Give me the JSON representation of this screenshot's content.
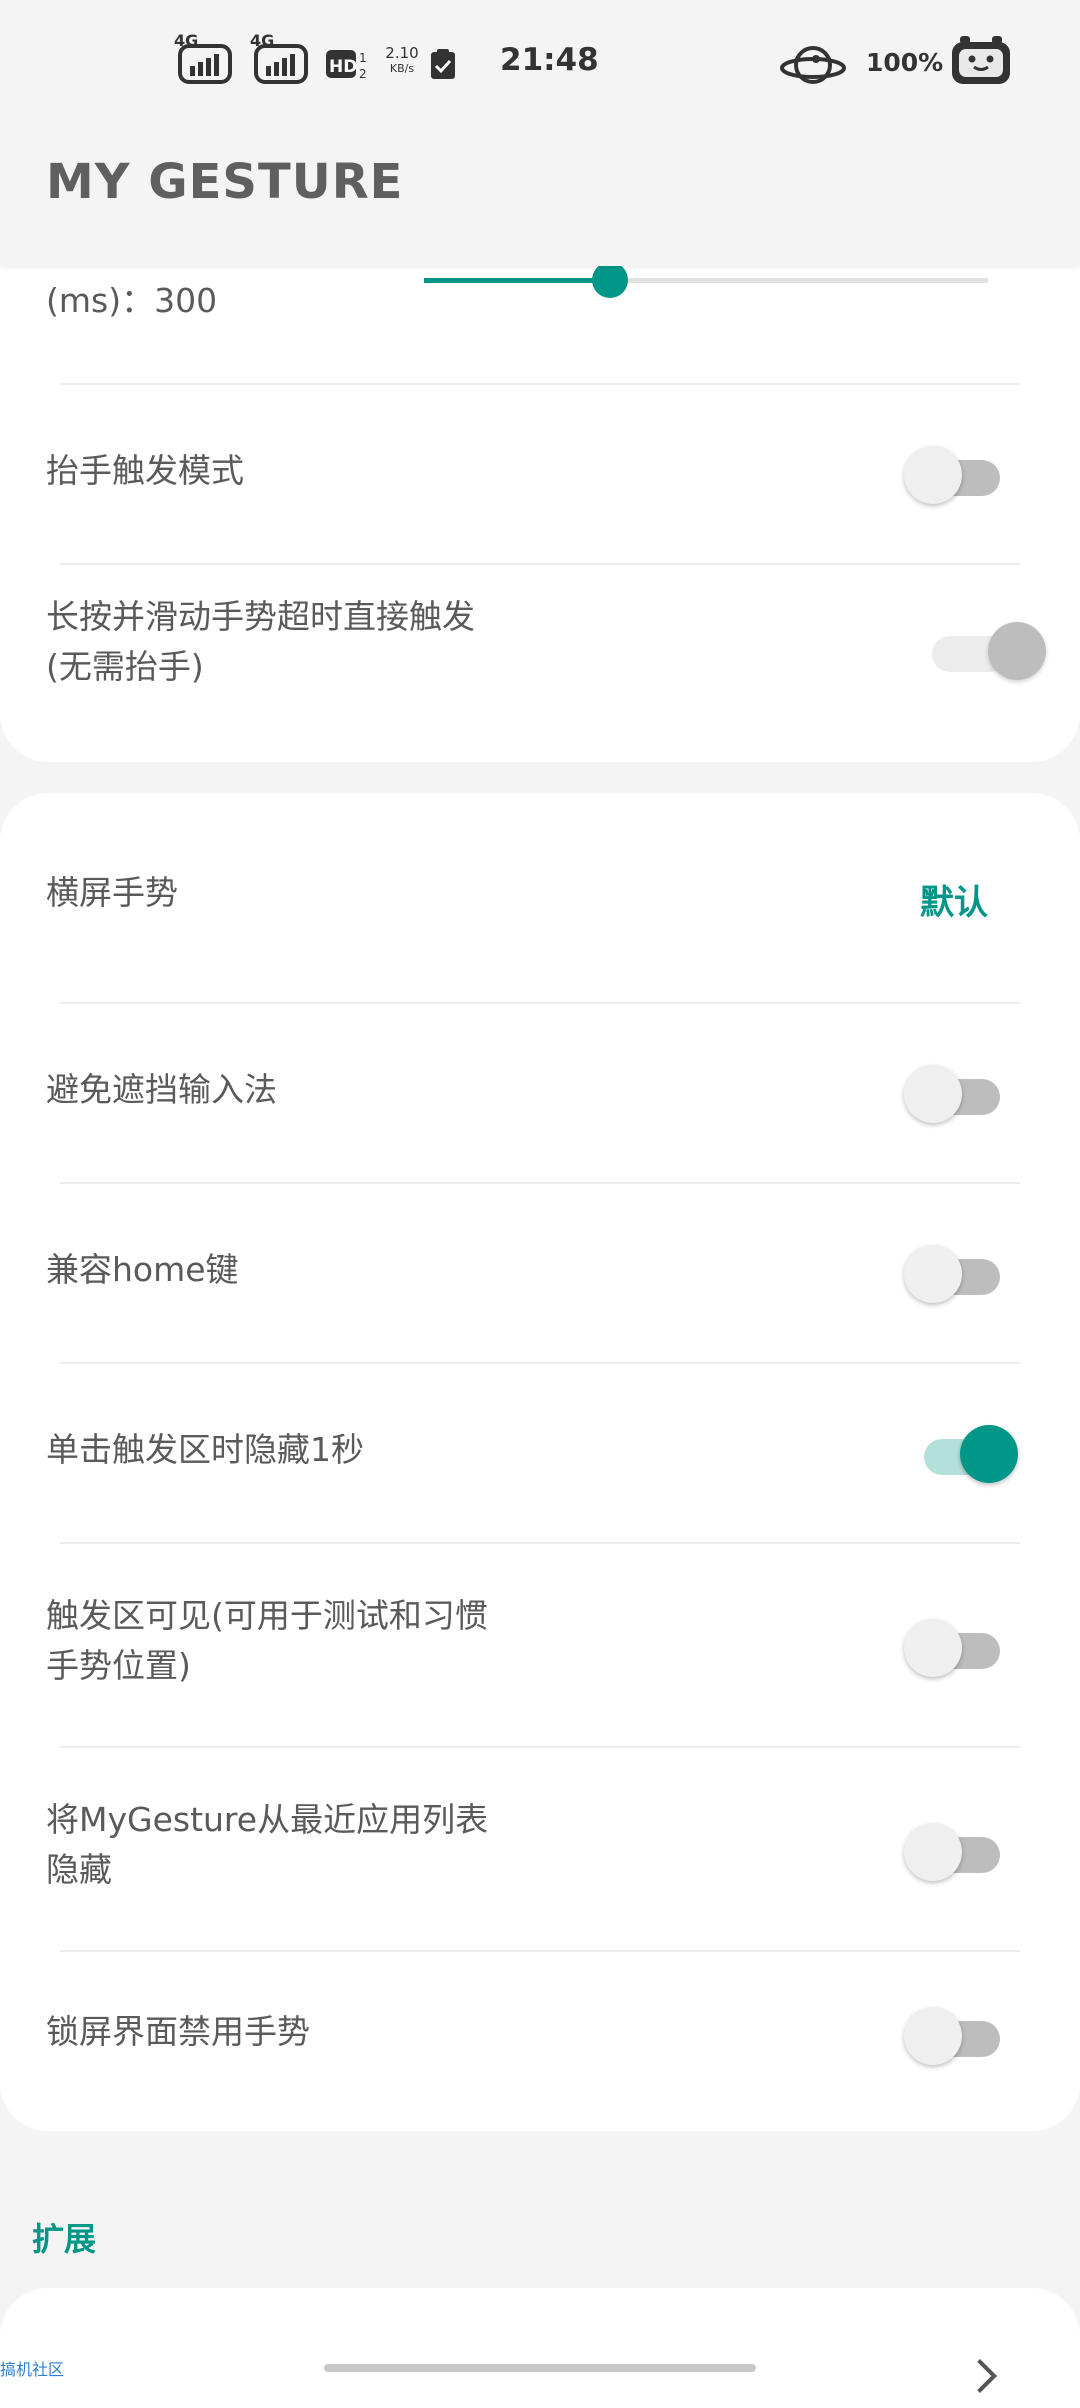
{
  "status_bar": {
    "network_1": "4G",
    "network_2": "4G",
    "hd_label": "HD",
    "speed_value": "2.10",
    "speed_unit": "KB/s",
    "time": "21:48",
    "battery": "100%"
  },
  "app_bar": {
    "title": "MY GESTURE"
  },
  "card1": {
    "slider_label_line2": "(ms)：300",
    "slider_value_fraction": 0.33,
    "rows": [
      {
        "label": "抬手触发模式",
        "state": "off"
      },
      {
        "label": "长按并滑动手势超时直接触发\n(无需抬手)",
        "state": "disabled"
      }
    ]
  },
  "card2": {
    "landscape_label": "横屏手势",
    "landscape_value": "默认",
    "rows": [
      {
        "label": "避免遮挡输入法",
        "state": "off"
      },
      {
        "label": "兼容home键",
        "state": "off"
      },
      {
        "label": "单击触发区时隐藏1秒",
        "state": "on"
      },
      {
        "label": "触发区可见(可用于测试和习惯\n手势位置)",
        "state": "off"
      },
      {
        "label": "将MyGesture从最近应用列表\n隐藏",
        "state": "off"
      },
      {
        "label": "锁屏界面禁用手势",
        "state": "off"
      }
    ]
  },
  "extension": {
    "section_title": "扩展"
  },
  "watermark": "搞机社区",
  "colors": {
    "accent": "#009688",
    "background": "#f4f4f4",
    "card": "#ffffff"
  }
}
